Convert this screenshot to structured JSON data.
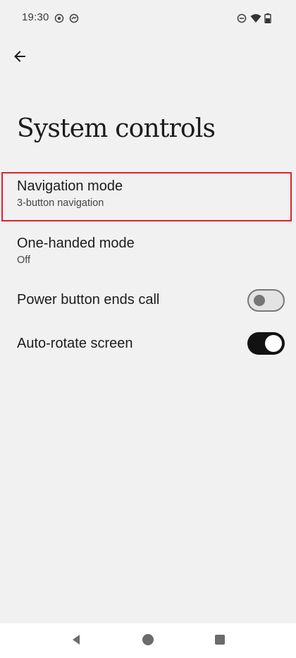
{
  "status_bar": {
    "time": "19:30",
    "left_icons": [
      "location-target-icon",
      "sync-icon"
    ],
    "right_icons": [
      "do-not-disturb-icon",
      "wifi-icon",
      "battery-icon"
    ]
  },
  "header": {
    "back_icon": "arrow-left-icon",
    "title": "System controls"
  },
  "settings": [
    {
      "title": "Navigation mode",
      "summary": "3-button navigation",
      "highlighted": true
    },
    {
      "title": "One-handed mode",
      "summary": "Off"
    },
    {
      "title": "Power button ends call",
      "toggle": "off"
    },
    {
      "title": "Auto-rotate screen",
      "toggle": "on"
    }
  ],
  "nav_bar": {
    "buttons": [
      "back-triangle-icon",
      "home-circle-icon",
      "recents-square-icon"
    ]
  },
  "colors": {
    "background": "#f1f1f1",
    "highlight_border": "#e0212b",
    "toggle_on": "#121212",
    "toggle_off": "#e3e3e3"
  }
}
